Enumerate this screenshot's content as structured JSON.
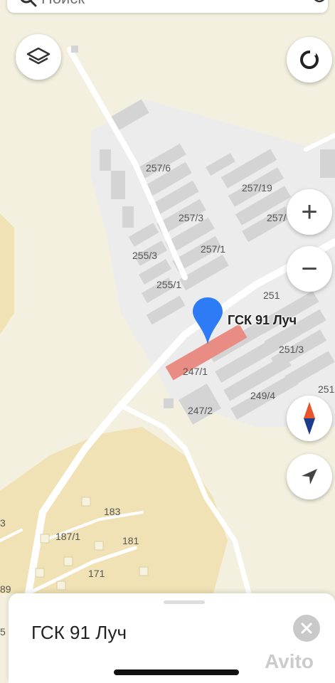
{
  "search": {
    "placeholder": "Поиск"
  },
  "map": {
    "labels": [
      "257/6",
      "257/19",
      "257/3",
      "257/",
      "257/1",
      "255/3",
      "255/1",
      "251",
      "251/3",
      "247/1",
      "249/4",
      "251",
      "247/2",
      "183",
      "187/1",
      "181",
      "171",
      "3",
      "89",
      "5"
    ],
    "marker_label": "ГСК 91 Луч",
    "colors": {
      "background": "#f3f0df",
      "garages": "#d4d4d4",
      "garage_block": "#ececec",
      "highlight": "#e98c84",
      "marker": "#2d7cf6",
      "yellow_area": "#f0e2b5"
    }
  },
  "controls": {
    "layers_icon": "layers-icon",
    "location_icon": "my-location-icon",
    "zoom_in": "+",
    "zoom_out": "−",
    "compass_icon": "compass-icon",
    "navigate_icon": "navigation-arrow-icon"
  },
  "sheet": {
    "title": "ГСК 91 Луч"
  },
  "watermark": "Avito"
}
